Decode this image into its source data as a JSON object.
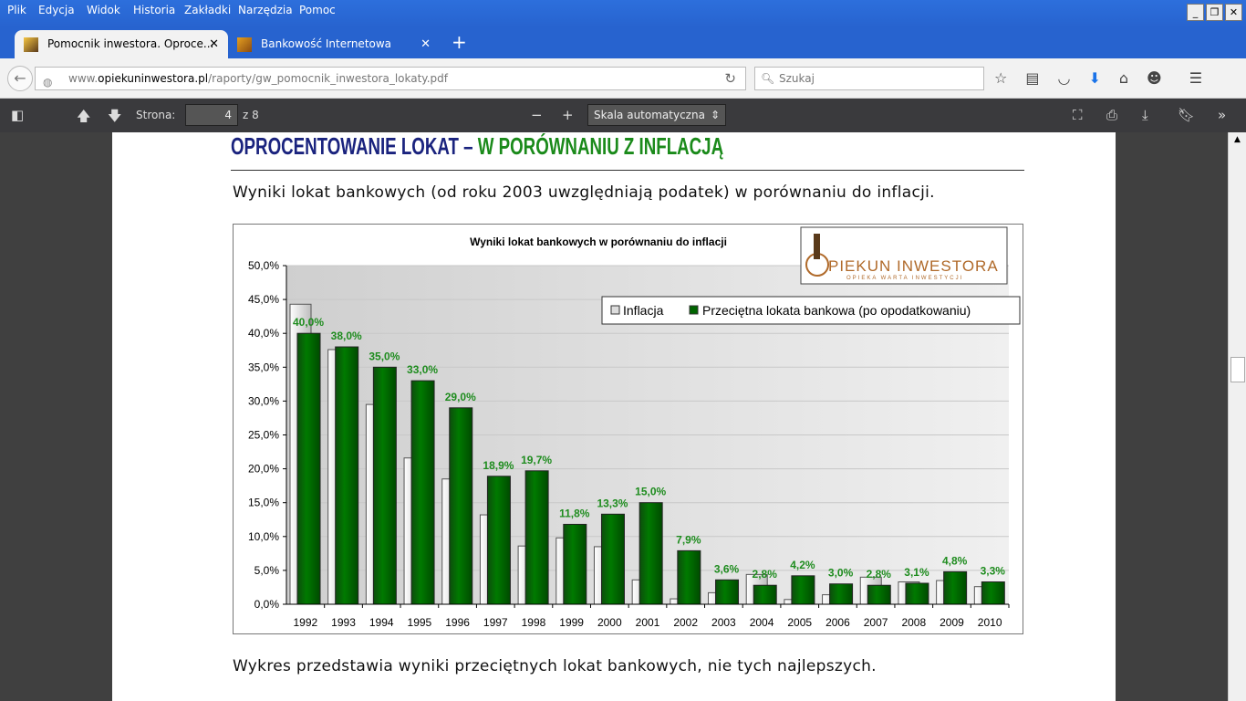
{
  "menu": [
    "Plik",
    "Edycja",
    "Widok",
    "Historia",
    "Zakładki",
    "Narzędzia",
    "Pomoc"
  ],
  "tabs": [
    {
      "label": "Pomocnik inwestora. Oproce..."
    },
    {
      "label": "Bankowość Internetowa"
    }
  ],
  "nav": {
    "url_prefix": "www.",
    "url_domain": "opiekuninwestora.pl",
    "url_path": "/raporty/gw_pomocnik_inwestora_lokaty.pdf",
    "search_placeholder": "Szukaj"
  },
  "pdf": {
    "page_label": "Strona:",
    "page": "4",
    "of": "z 8",
    "scale": "Skala automatyczna"
  },
  "doc": {
    "heading_a": "OPROCENTOWANIE LOKAT – ",
    "heading_b": "W PORÓWNANIU Z INFLACJĄ",
    "intro": "Wyniki lokat bankowych (od roku 2003 uwzględniają podatek) w porównaniu do inflacji.",
    "caption": "Wykres przedstawia wyniki przeciętnych lokat bankowych, nie tych najlepszych.",
    "logo_text": "OPIEKUN INWESTORA",
    "logo_sub": "OPIEKA WARTA INWESTYCJI"
  },
  "colors": {
    "inflation": "#d9d9d9",
    "deposit": "#006400",
    "label": "#1e8c1e"
  },
  "chart_data": {
    "type": "bar",
    "title": "Wyniki lokat bankowych w porównaniu do inflacji",
    "categories": [
      "1992",
      "1993",
      "1994",
      "1995",
      "1996",
      "1997",
      "1998",
      "1999",
      "2000",
      "2001",
      "2002",
      "2003",
      "2004",
      "2005",
      "2006",
      "2007",
      "2008",
      "2009",
      "2010"
    ],
    "series": [
      {
        "name": "Inflacja",
        "values": [
          44.3,
          37.6,
          29.5,
          21.6,
          18.5,
          13.2,
          8.6,
          9.8,
          8.5,
          3.6,
          0.8,
          1.7,
          4.4,
          0.7,
          1.4,
          4.0,
          3.3,
          3.5,
          2.6
        ]
      },
      {
        "name": "Przeciętna lokata bankowa (po opodatkowaniu)",
        "values": [
          40.0,
          38.0,
          35.0,
          33.0,
          29.0,
          18.9,
          19.7,
          11.8,
          13.3,
          15.0,
          7.9,
          3.6,
          2.8,
          4.2,
          3.0,
          2.8,
          3.1,
          4.8,
          3.3
        ],
        "labels": [
          "40,0%",
          "38,0%",
          "35,0%",
          "33,0%",
          "29,0%",
          "18,9%",
          "19,7%",
          "11,8%",
          "13,3%",
          "15,0%",
          "7,9%",
          "3,6%",
          "2,8%",
          "4,2%",
          "3,0%",
          "2,8%",
          "3,1%",
          "4,8%",
          "3,3%"
        ]
      }
    ],
    "yticks": [
      "0,0%",
      "5,0%",
      "10,0%",
      "15,0%",
      "20,0%",
      "25,0%",
      "30,0%",
      "35,0%",
      "40,0%",
      "45,0%",
      "50,0%"
    ],
    "ylim": [
      0,
      50
    ],
    "grid": true,
    "legend": "top-right"
  }
}
